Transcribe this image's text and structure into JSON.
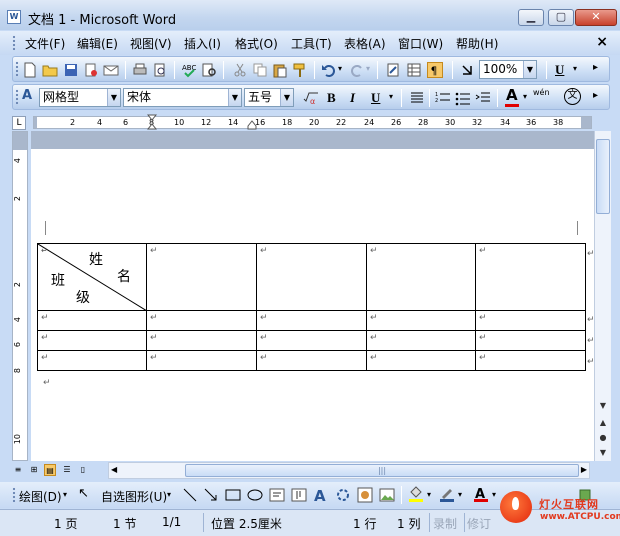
{
  "window": {
    "title": "文档 1 - Microsoft Word",
    "icon_text": "W"
  },
  "menu": {
    "items": [
      "文件(F)",
      "编辑(E)",
      "视图(V)",
      "插入(I)",
      "格式(O)",
      "工具(T)",
      "表格(A)",
      "窗口(W)",
      "帮助(H)"
    ],
    "close": "×"
  },
  "standard_toolbar": {
    "zoom": "100%",
    "underline": "U"
  },
  "format_toolbar": {
    "style_icon": "A",
    "style": "网格型",
    "font": "宋体",
    "size": "五号",
    "bold": "B",
    "italic": "I",
    "underline": "U",
    "font_color": "A",
    "wen": "wén",
    "phonetic": "文"
  },
  "ruler": {
    "tab_marker": "L",
    "h_numbers": [
      "2",
      "4",
      "6",
      "8",
      "10",
      "12",
      "14",
      "16",
      "18",
      "20",
      "22",
      "24",
      "26",
      "28",
      "30",
      "32",
      "34",
      "36",
      "38"
    ],
    "v_numbers": [
      "4",
      "2",
      "",
      "2",
      "4",
      "6",
      "8",
      "10"
    ]
  },
  "table": {
    "diagonal_header": {
      "top_right_1": "姓",
      "top_right_2": "名",
      "bottom_left_1": "班",
      "bottom_left_2": "级"
    },
    "cell_mark": "↵",
    "data_rows": 3,
    "columns": 5
  },
  "draw_toolbar": {
    "draw": "绘图(D)",
    "autoshapes": "自选图形(U)"
  },
  "status": {
    "page": "1 页",
    "section": "1 节",
    "page_of": "1/1",
    "position": "位置 2.5厘米",
    "line": "1 行",
    "col": "1 列",
    "rec": "录制",
    "trk": "修订"
  },
  "watermark": {
    "cn": "灯火互联网",
    "en": "www.ATCPU.com"
  },
  "colors": {
    "accent": "#c8dbf5",
    "font_color_bar": "#e00000",
    "highlight_bar": "#ffff00"
  }
}
